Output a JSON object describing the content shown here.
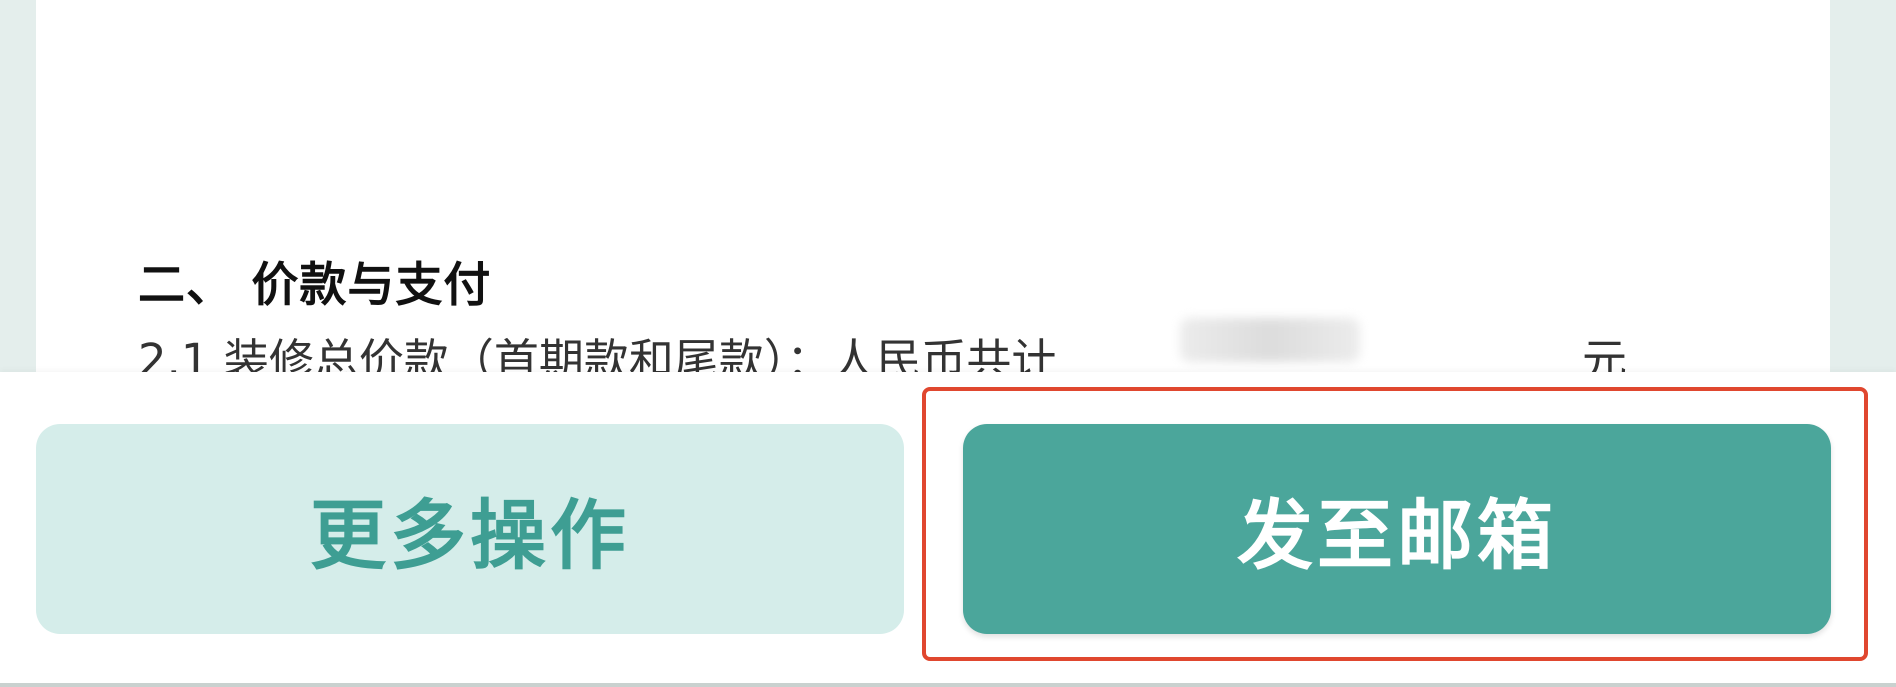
{
  "document": {
    "section_heading": "二、 价款与支付",
    "clause_text": "2.1 装修总价款（首期款和尾款）：人民币共计",
    "amount_hidden": "25.00",
    "unit": "元"
  },
  "actions": {
    "more_label": "更多操作",
    "email_label": "发至邮箱"
  },
  "colors": {
    "primary": "#4ba69b",
    "secondary_bg": "#d5edea",
    "secondary_text": "#3e9e93",
    "highlight": "#e0472f"
  }
}
